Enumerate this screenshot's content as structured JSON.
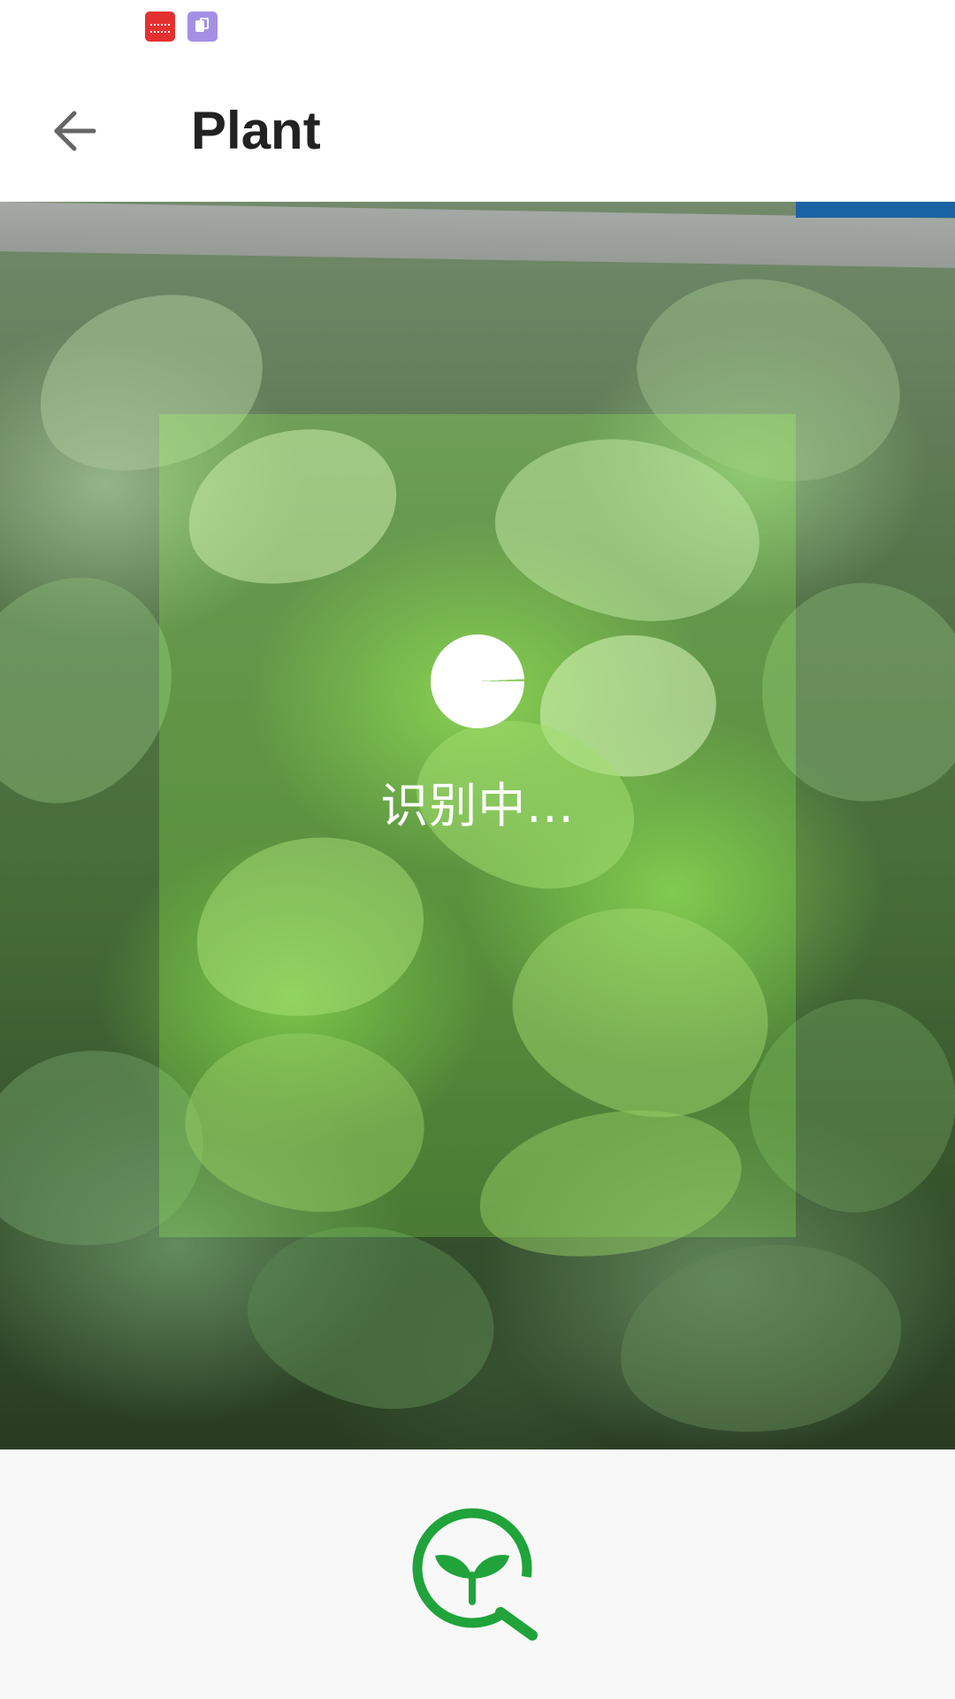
{
  "status_bar": {
    "icons": [
      "notification-app-icon-red",
      "notification-app-icon-purple"
    ]
  },
  "app_bar": {
    "back_icon": "arrow-left-icon",
    "title": "Plant"
  },
  "camera": {
    "loading_text": "识别中..."
  },
  "bottom_bar": {
    "logo_icon": "plant-search-logo-icon"
  },
  "colors": {
    "accent_green": "#1fa33a",
    "title_text": "#222222",
    "bottom_background": "#f8f8f8"
  }
}
